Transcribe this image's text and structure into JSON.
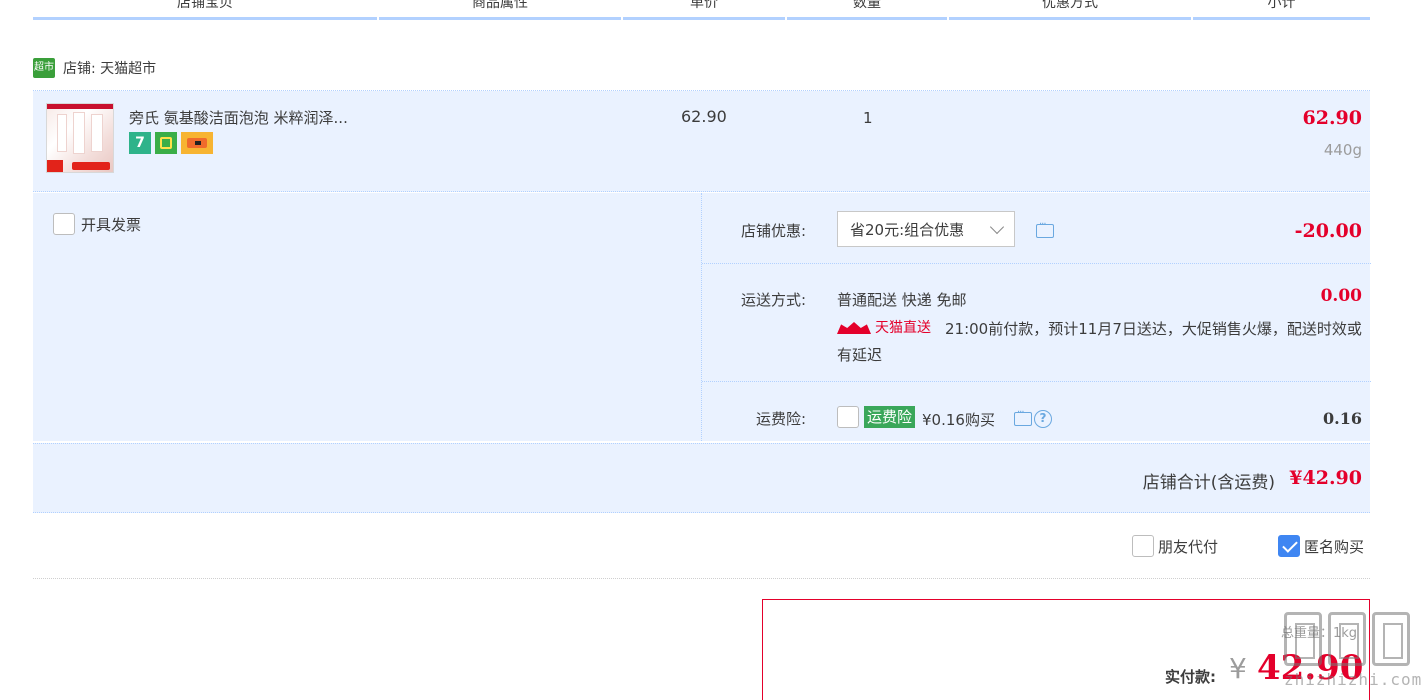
{
  "header": {
    "columns": [
      "店铺宝贝",
      "商品属性",
      "单价",
      "数量",
      "优惠方式",
      "小计"
    ]
  },
  "shop": {
    "icon_label": "超市",
    "name": "店铺: 天猫超市"
  },
  "item": {
    "title": "旁氏 氨基酸洁面泡泡 米粹润泽...",
    "badge_7": "7",
    "unit_price": "62.90",
    "quantity": "1",
    "subtotal": "62.90",
    "weight": "440g"
  },
  "invoice": {
    "label": "开具发票",
    "checked": false
  },
  "discount": {
    "label": "店铺优惠:",
    "selected": "省20元:组合优惠",
    "amount": "-20.00"
  },
  "shipping": {
    "label": "运送方式:",
    "method": "普通配送 快递 免邮",
    "tmall_label": "天猫直送",
    "note": "21:00前付款，预计11月7日送达，大促销售火爆，配送时效或有延迟",
    "amount": "0.00"
  },
  "insurance": {
    "label": "运费险:",
    "tag": "运费险",
    "price_text": "¥0.16购买",
    "amount": "0.16"
  },
  "shop_total": {
    "label": "店铺合计(含运费)",
    "amount": "¥42.90"
  },
  "options": {
    "friend_pay_label": "朋友代付",
    "anonymous_label": "匿名购买",
    "anonymous_checked": true
  },
  "final": {
    "total_weight": "总重量：1kg",
    "pay_label": "实付款:",
    "currency": "¥",
    "amount": "42.90"
  },
  "watermark": {
    "text": "zhizhizhi.com"
  },
  "colors": {
    "accent_red": "#e4002b",
    "header_line": "#b2d1ff",
    "row_bg": "#eaf2ff",
    "check_blue": "#3f86f2",
    "insurance_green": "#3aa75a"
  }
}
